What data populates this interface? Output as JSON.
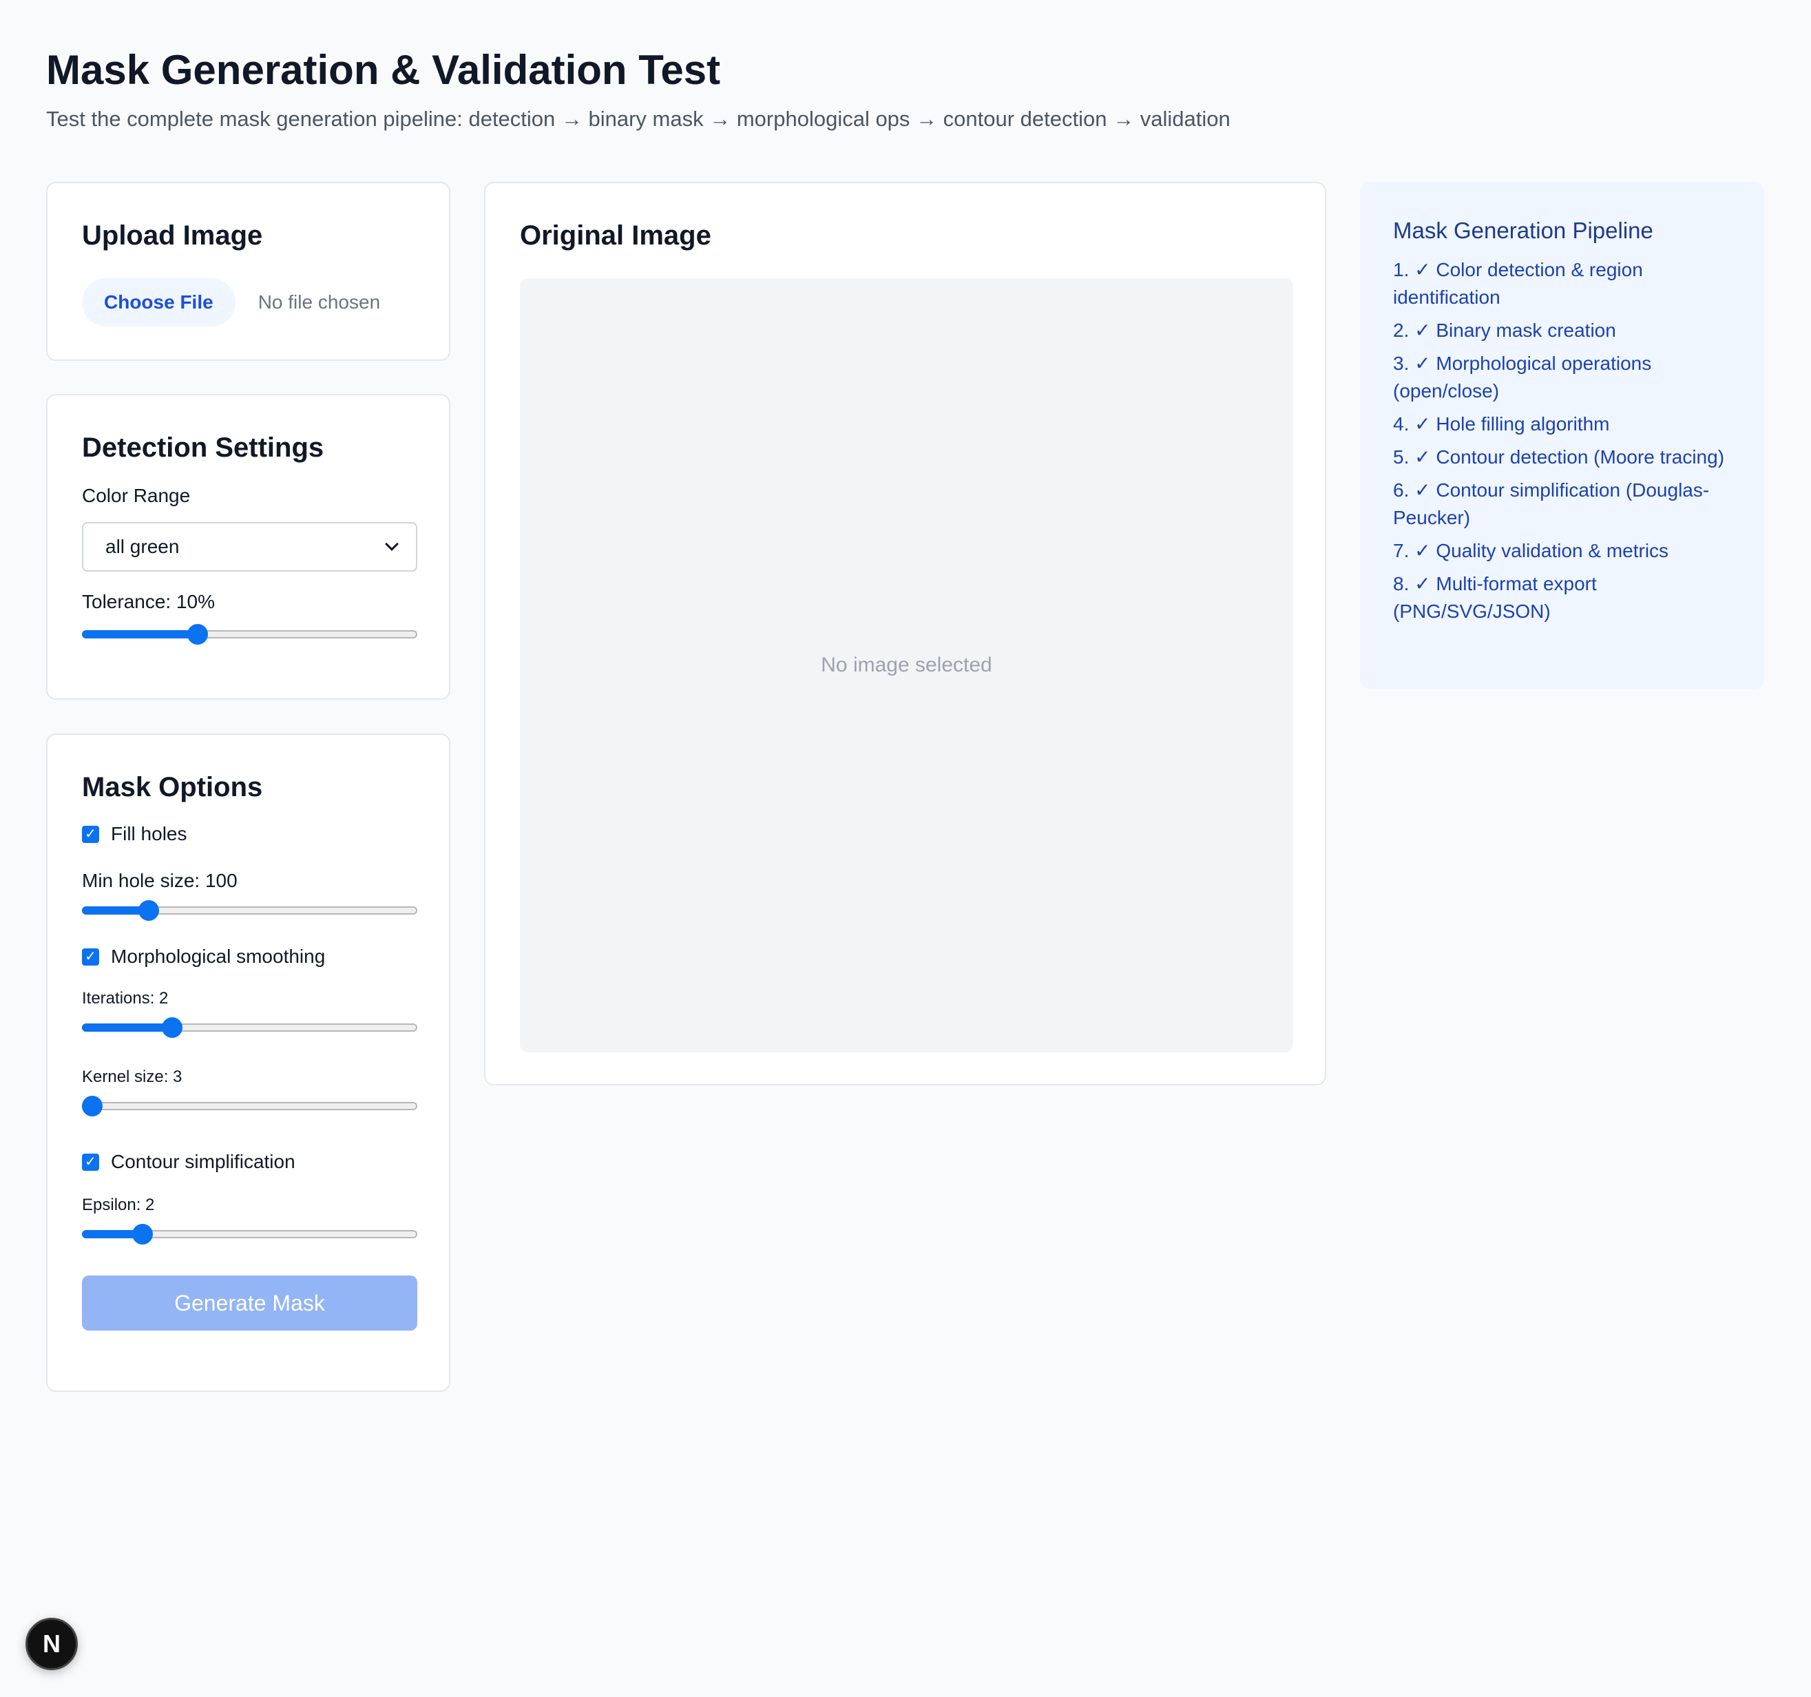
{
  "page": {
    "title": "Mask Generation & Validation Test",
    "subtitle": "Test the complete mask generation pipeline: detection → binary mask → morphological ops → contour detection → validation"
  },
  "upload": {
    "heading": "Upload Image",
    "choose_label": "Choose File",
    "status": "No file chosen"
  },
  "detection": {
    "heading": "Detection Settings",
    "color_range_label": "Color Range",
    "color_range_value": "all green",
    "tolerance_label": "Tolerance: 10%",
    "tolerance_fraction": 0.345
  },
  "mask": {
    "heading": "Mask Options",
    "fill_holes_label": "Fill holes",
    "fill_holes_checked": true,
    "min_hole_label": "Min hole size: 100",
    "min_hole_fraction": 0.2,
    "morph_label": "Morphological smoothing",
    "morph_checked": true,
    "iterations_label": "Iterations: 2",
    "iterations_fraction": 0.27,
    "kernel_label": "Kernel size: 3",
    "kernel_fraction": 0.03,
    "contour_label": "Contour simplification",
    "contour_checked": true,
    "epsilon_label": "Epsilon: 2",
    "epsilon_fraction": 0.18,
    "generate_label": "Generate Mask"
  },
  "original": {
    "heading": "Original Image",
    "placeholder": "No image selected"
  },
  "pipeline": {
    "heading": "Mask Generation Pipeline",
    "steps": [
      "1. ✓ Color detection & region identification",
      "2. ✓ Binary mask creation",
      "3. ✓ Morphological operations (open/close)",
      "4. ✓ Hole filling algorithm",
      "5. ✓ Contour detection (Moore tracing)",
      "6. ✓ Contour simplification (Douglas-Peucker)",
      "7. ✓ Quality validation & metrics",
      "8. ✓ Multi-format export (PNG/SVG/JSON)"
    ]
  },
  "badge": {
    "letter": "N"
  },
  "colors": {
    "accent": "#0b72f0",
    "button_disabled": "#93b4f5",
    "panel_blue": "#eff6ff",
    "pipeline_text": "#1e40af"
  }
}
